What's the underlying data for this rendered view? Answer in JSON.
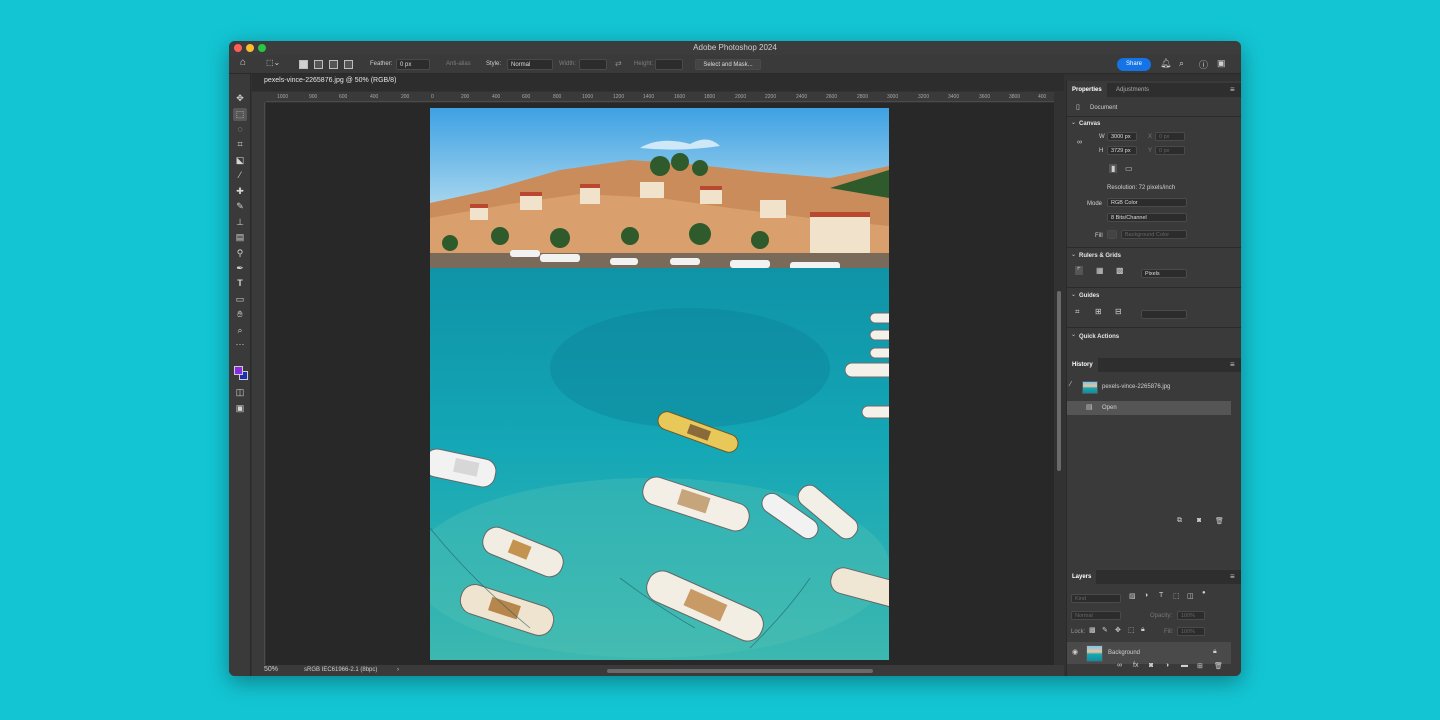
{
  "window": {
    "title": "Adobe Photoshop 2024"
  },
  "options_bar": {
    "feather_label": "Feather:",
    "feather_value": "0 px",
    "anti_alias_label": "Anti-alias",
    "style_label": "Style:",
    "style_value": "Normal",
    "width_label": "Width:",
    "height_label": "Height:",
    "select_mask_label": "Select and Mask...",
    "share_label": "Share"
  },
  "document": {
    "tab_title": "pexels-vince-2265876.jpg @ 50% (RGB/8)",
    "ruler_ticks": [
      "1000",
      "900",
      "600",
      "400",
      "200",
      "0",
      "200",
      "400",
      "600",
      "800",
      "1000",
      "1200",
      "1400",
      "1600",
      "1800",
      "2000",
      "2200",
      "2400",
      "2600",
      "2800",
      "3000",
      "3200",
      "3400",
      "3600",
      "3800",
      "400"
    ],
    "zoom": "50%",
    "color_profile": "sRGB IEC61966-2.1 (8bpc)"
  },
  "properties": {
    "tab_properties": "Properties",
    "tab_adjustments": "Adjustments",
    "doc_label": "Document",
    "canvas_section": "Canvas",
    "w_label": "W",
    "w_value": "3000 px",
    "h_label": "H",
    "h_value": "3729 px",
    "x_label": "X",
    "x_value": "0 px",
    "y_label": "Y",
    "y_value": "0 px",
    "resolution": "Resolution: 72 pixels/inch",
    "mode_label": "Mode",
    "mode_value": "RGB Color",
    "bits_value": "8 Bits/Channel",
    "fill_label": "Fill",
    "fill_value": "Background Color",
    "rulers_section": "Rulers & Grids",
    "units_value": "Pixels",
    "guides_section": "Guides",
    "quick_actions_section": "Quick Actions"
  },
  "history": {
    "tab": "History",
    "items": [
      {
        "label": "pexels-vince-2265876.jpg"
      },
      {
        "label": "Open"
      }
    ]
  },
  "layers": {
    "tab": "Layers",
    "kind_label": "Kind",
    "blend_value": "Normal",
    "opacity_label": "Opacity:",
    "opacity_value": "100%",
    "lock_label": "Lock:",
    "fill_label": "Fill:",
    "fill_value": "100%",
    "items": [
      {
        "name": "Background"
      }
    ]
  },
  "colors": {
    "foreground": "#8a2be2",
    "background": "#1c2fb0",
    "accent": "#1473e6",
    "backdrop": "#13c5d3"
  }
}
